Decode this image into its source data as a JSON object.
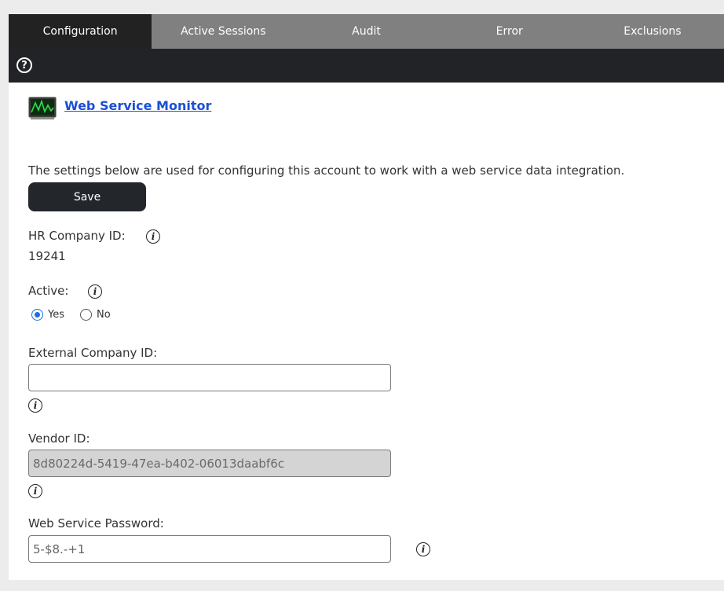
{
  "tabs": [
    {
      "label": "Configuration",
      "active": true
    },
    {
      "label": "Active Sessions",
      "active": false
    },
    {
      "label": "Audit",
      "active": false
    },
    {
      "label": "Error",
      "active": false
    },
    {
      "label": "Exclusions",
      "active": false
    }
  ],
  "header": {
    "link_label": "Web Service Monitor"
  },
  "description": "The settings below are used for configuring this account to work with a web service data integration.",
  "save_label": "Save",
  "fields": {
    "hr_company_id": {
      "label": "HR Company ID:",
      "value": "19241"
    },
    "active": {
      "label": "Active:",
      "options": [
        {
          "label": "Yes",
          "checked": true
        },
        {
          "label": "No",
          "checked": false
        }
      ]
    },
    "external_company_id": {
      "label": "External Company ID:",
      "value": ""
    },
    "vendor_id": {
      "label": "Vendor ID:",
      "value": "8d80224d-5419-47ea-b402-06013daabf6c"
    },
    "web_service_password": {
      "label": "Web Service Password:",
      "value": "5-$8.-+1"
    }
  },
  "colors": {
    "tab_active": "#222222",
    "tab_inactive": "#808080",
    "link": "#1a4fd6",
    "save_button": "#23262b"
  }
}
